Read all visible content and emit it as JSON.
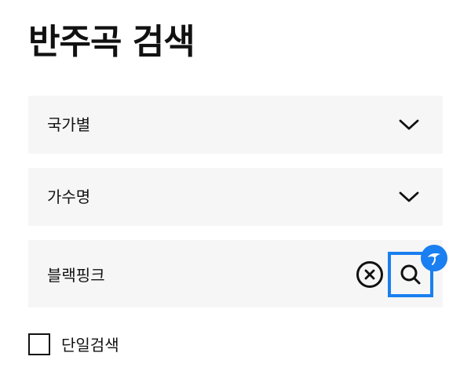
{
  "page": {
    "title": "반주곡 검색"
  },
  "filters": {
    "country": {
      "label": "국가별",
      "icon": "chevron-down-icon"
    },
    "singer": {
      "label": "가수명",
      "icon": "chevron-down-icon"
    }
  },
  "search": {
    "value": "블랙핑크",
    "clear_icon": "close-circle-icon",
    "search_icon": "magnifier-icon",
    "badge_icon": "assistant-bird-icon",
    "accent_color": "#1a7ff0"
  },
  "options": {
    "single_search_label": "단일검색",
    "single_search_checked": false
  }
}
